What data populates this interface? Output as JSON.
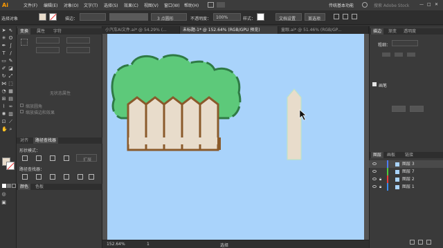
{
  "menubar": {
    "logo": "Ai",
    "items": [
      "文件(F)",
      "编辑(E)",
      "对象(O)",
      "文字(T)",
      "选择(S)",
      "效果(C)",
      "视图(V)",
      "窗口(W)",
      "帮助(H)"
    ],
    "workspace": "传统基本功能",
    "search_placeholder": "搜索 Adobe Stock"
  },
  "controlbar": {
    "selection_label": "选择对象",
    "stroke_label": "描边：",
    "brush_label": "3 点圆形",
    "opacity_label": "不透明度：",
    "opacity_value": "100%",
    "style_label": "样式：",
    "doc_setup_button": "文档设置",
    "prefs_button": "首选项"
  },
  "doc_tabs": [
    "小汽车AI文件.ai* @ 54.29% (...",
    "未标题-1* @ 152.64% (RGB/GPU 预览)",
    "童眼.ai* @ 51.46% (RGB/GP..."
  ],
  "left_panel": {
    "tabs": [
      "变换",
      "属性",
      "字符"
    ],
    "no_properties": "无状态属性",
    "checkbox_1": "缩放圆角",
    "checkbox_2": "缩放描边和效果",
    "tabs2": [
      "对齐",
      "路径查找器"
    ],
    "shape_modes": "形状模式：",
    "expand_button": "扩展",
    "pathfinders": "路径查找器：",
    "tabs3": [
      "颜色",
      "色板"
    ]
  },
  "right_panel": {
    "tabs": [
      "描边",
      "渐变",
      "透明度"
    ],
    "weight_label": "粗细：",
    "section": "画笔",
    "layers_tabs": [
      "图层",
      "画板",
      "链接"
    ],
    "layers": [
      {
        "name": "图层 3",
        "color": "#4f7df5",
        "locked": false
      },
      {
        "name": "图层 7",
        "color": "#4fcd3a",
        "locked": false
      },
      {
        "name": "图层 2",
        "color": "#ee3b3b",
        "locked": true
      },
      {
        "name": "图层 1",
        "color": "#3b8cee",
        "locked": true
      }
    ]
  },
  "status": {
    "zoom": "152.64%",
    "page": "1",
    "tool": "选择"
  },
  "colors": {
    "artboard_bg": "#a9d3fb",
    "tree_green": "#5dc97a",
    "tree_outline": "#2f7a45",
    "fence_fill": "#e8dccb",
    "fence_outline": "#8a5a2b"
  }
}
